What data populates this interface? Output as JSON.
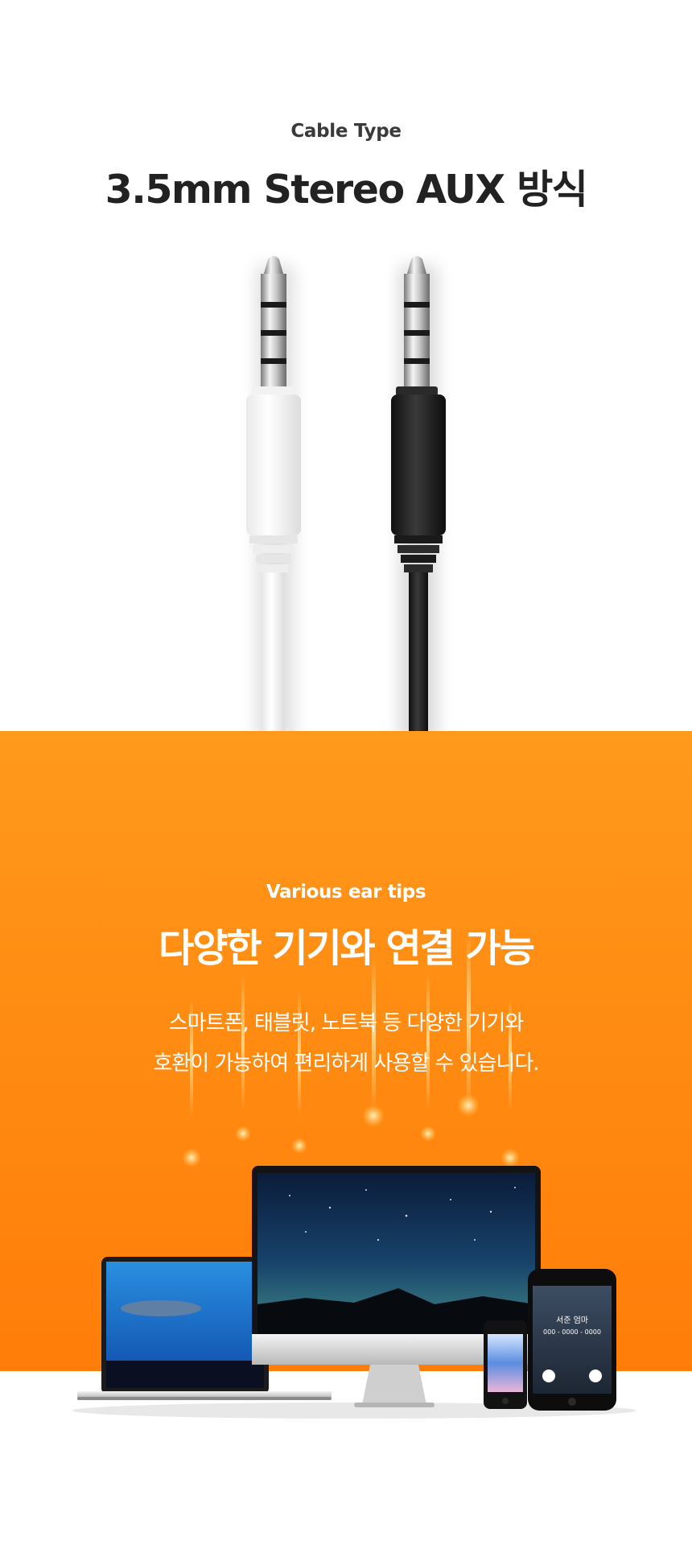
{
  "section_cable": {
    "subtitle": "Cable Type",
    "title": "3.5mm Stereo AUX 방식"
  },
  "section_devices": {
    "subtitle": "Various ear tips",
    "title": "다양한 기기와 연결 가능",
    "desc_line1": "스마트폰, 태블릿, 노트북 등 다양한 기기와",
    "desc_line2": "호환이 가능하여 편리하게 사용할 수 있습니다."
  },
  "phone_screen": {
    "caller_name": "서준 엄마",
    "caller_number": "000 - 0000 - 0000"
  },
  "colors": {
    "orange_top": "#ff9a1c",
    "orange_bottom": "#ff7d0a",
    "title_dark": "#222222"
  }
}
